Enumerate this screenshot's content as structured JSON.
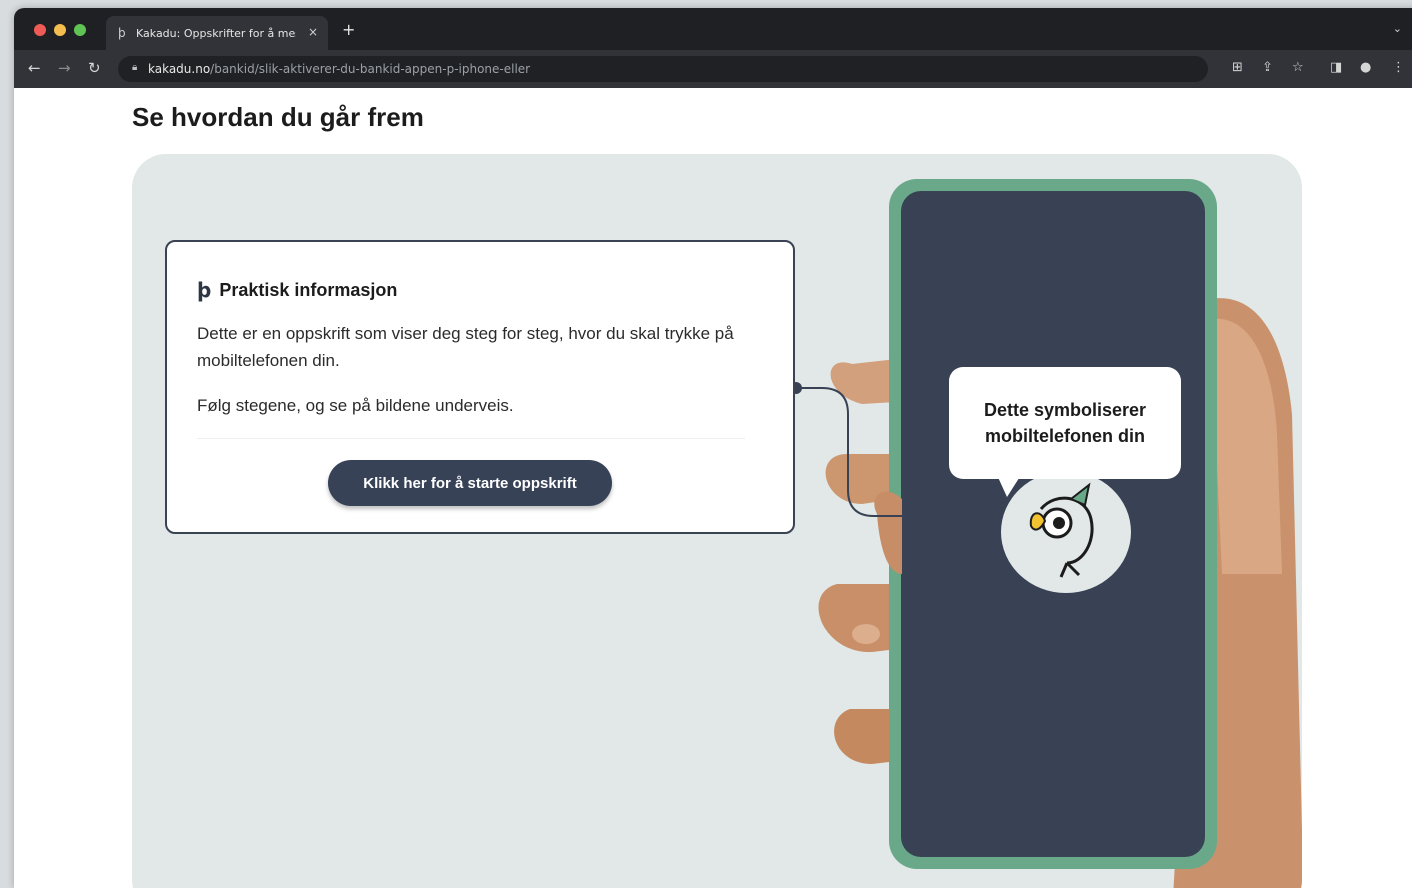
{
  "browser": {
    "tab_title": "Kakadu: Oppskrifter for å mes",
    "tab_close": "×",
    "new_tab": "+",
    "url_domain": "kakadu.no",
    "url_path": "/bankid/slik-aktiverer-du-bankid-appen-p-iphone-eller"
  },
  "page": {
    "title": "Se hvordan du går frem"
  },
  "info_card": {
    "heading": "Praktisk informasjon",
    "paragraph1": "Dette er en oppskrift som viser deg steg for steg, hvor du skal trykke på mobiltelefonen din.",
    "paragraph2": "Følg stegene, og se på bildene underveis.",
    "button_label": "Klikk her for å starte oppskrift"
  },
  "phone": {
    "bubble_text": "Dette symboliserer mobiltelefonen din"
  },
  "colors": {
    "stage_bg": "#e1e8e7",
    "phone_frame": "#6aa88a",
    "phone_screen": "#394255",
    "button_bg": "#374257",
    "skin": "#d4a07c"
  }
}
